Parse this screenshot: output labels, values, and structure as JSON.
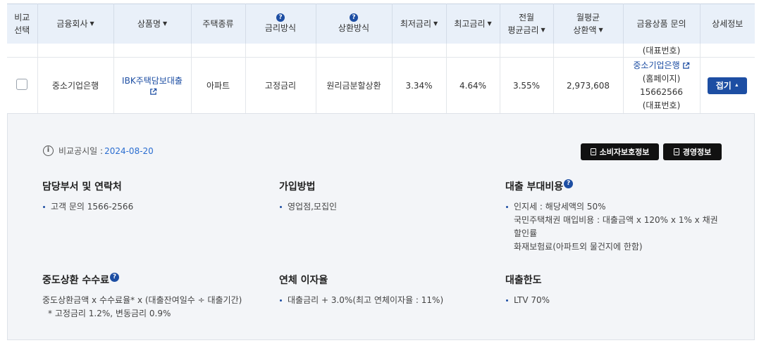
{
  "columns": [
    {
      "label_lines": [
        "비교",
        "선택"
      ],
      "sortable": false
    },
    {
      "label": "금융회사",
      "sortable": true
    },
    {
      "label": "상품명",
      "sortable": true
    },
    {
      "label": "주택종류",
      "sortable": false
    },
    {
      "label": "금리방식",
      "help": true
    },
    {
      "label": "상환방식",
      "help": true
    },
    {
      "label": "최저금리",
      "sortable": true
    },
    {
      "label": "최고금리",
      "sortable": true
    },
    {
      "label_lines": [
        "전월",
        "평균금리"
      ],
      "sortable": true
    },
    {
      "label_lines": [
        "월평균",
        "상환액"
      ],
      "sortable": true
    },
    {
      "label": "금융상품 문의"
    },
    {
      "label": "상세정보"
    }
  ],
  "prev_row_contact_tail": "(대표번호)",
  "row": {
    "company": "중소기업은행",
    "product": "IBK주택담보대출",
    "house_type": "아파트",
    "rate_type": "고정금리",
    "repay_type": "원리금분할상환",
    "min_rate": "3.34%",
    "max_rate": "4.64%",
    "avg_rate": "3.55%",
    "monthly_payment": "2,973,608",
    "contact_company": "중소기업은행",
    "contact_homepage": "(홈페이지)",
    "contact_phone": "15662566",
    "contact_phone_label": "(대표번호)",
    "fold_label": "접기"
  },
  "detail": {
    "disclosure_label": "비교공시일 :",
    "disclosure_date": "2024-08-20",
    "btn_consumer": "소비자보호정보",
    "btn_management": "경영정보",
    "dept_title": "담당부서 및 연락처",
    "dept_items": [
      "고객 문의 1566-2566"
    ],
    "join_title": "가입방법",
    "join_items": [
      "영업점,모집인"
    ],
    "cost_title": "대출 부대비용",
    "cost_line1": "인지세 : 해당세액의 50%",
    "cost_line2": "국민주택채권 매입비용 : 대출금액 x 120% x 1% x 채권",
    "cost_line3": "할인률",
    "cost_line4": "화재보험료(아파트외 물건지에 한함)",
    "fee_title": "중도상환 수수료",
    "fee_line1": "중도상환금액 x 수수료율* x (대출잔여일수 ÷ 대출기간)",
    "fee_line2": "* 고정금리 1.2%, 변동금리 0.9%",
    "overdue_title": "연체 이자율",
    "overdue_items": [
      "대출금리 + 3.0%(최고 연체이자율 : 11%)"
    ],
    "limit_title": "대출한도",
    "limit_items": [
      "LTV 70%"
    ]
  }
}
